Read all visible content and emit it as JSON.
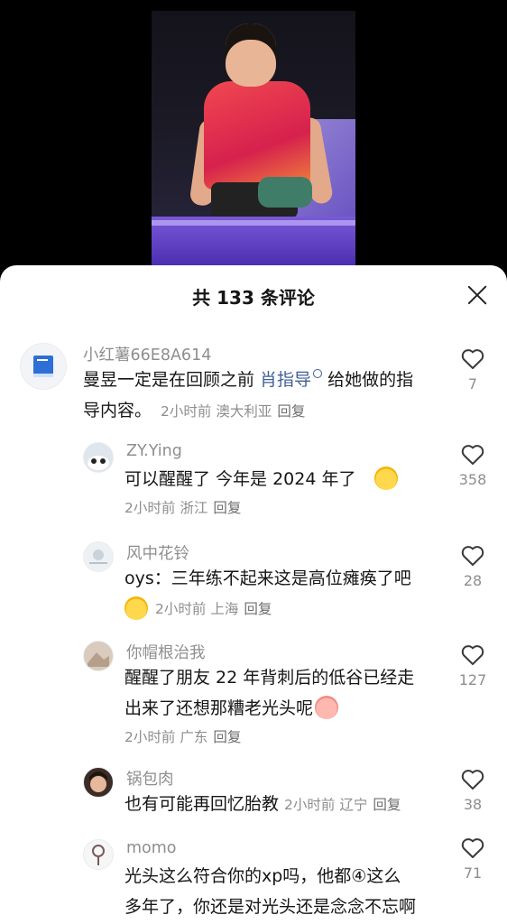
{
  "sheet": {
    "title": "共 133 条评论"
  },
  "comments": [
    {
      "username": "小红薯66E8A614",
      "text_before": "曼昱一定是在回顾之前 ",
      "link_text": "肖指导",
      "text_after": " 给她做的指",
      "text_line2": "导内容。",
      "time": "2小时前",
      "location": "澳大利亚",
      "reply": "回复",
      "likes": "7"
    },
    {
      "username": "ZY.Ying",
      "text": "可以醒醒了   今年是 2024 年了",
      "time": "2小时前",
      "location": "浙江",
      "reply": "回复",
      "likes": "358"
    },
    {
      "username": "风中花铃",
      "text": "oys：三年练不起来这是高位瘫痪了吧",
      "time": "2小时前",
      "location": "上海",
      "reply": "回复",
      "likes": "28"
    },
    {
      "username": "你帽根治我",
      "text_line1": "醒醒了朋友 22 年背刺后的低谷已经走",
      "text_line2": "出来了还想那糟老光头呢",
      "time": "2小时前",
      "location": "广东",
      "reply": "回复",
      "likes": "127"
    },
    {
      "username": "锅包肉",
      "text": "也有可能再回忆胎教",
      "time": "2小时前",
      "location": "辽宁",
      "reply": "回复",
      "likes": "38"
    },
    {
      "username": "momo",
      "text_line1": "光头这么符合你的xp吗，他都④这么",
      "text_line2": "多年了，你还是对光头还是念念不忘啊",
      "likes": "71"
    }
  ],
  "icons": {
    "like": "heart-outline-icon",
    "close": "close-icon"
  },
  "colors": {
    "link": "#3f5f95",
    "muted": "#8e8e8e",
    "text": "#161616"
  }
}
